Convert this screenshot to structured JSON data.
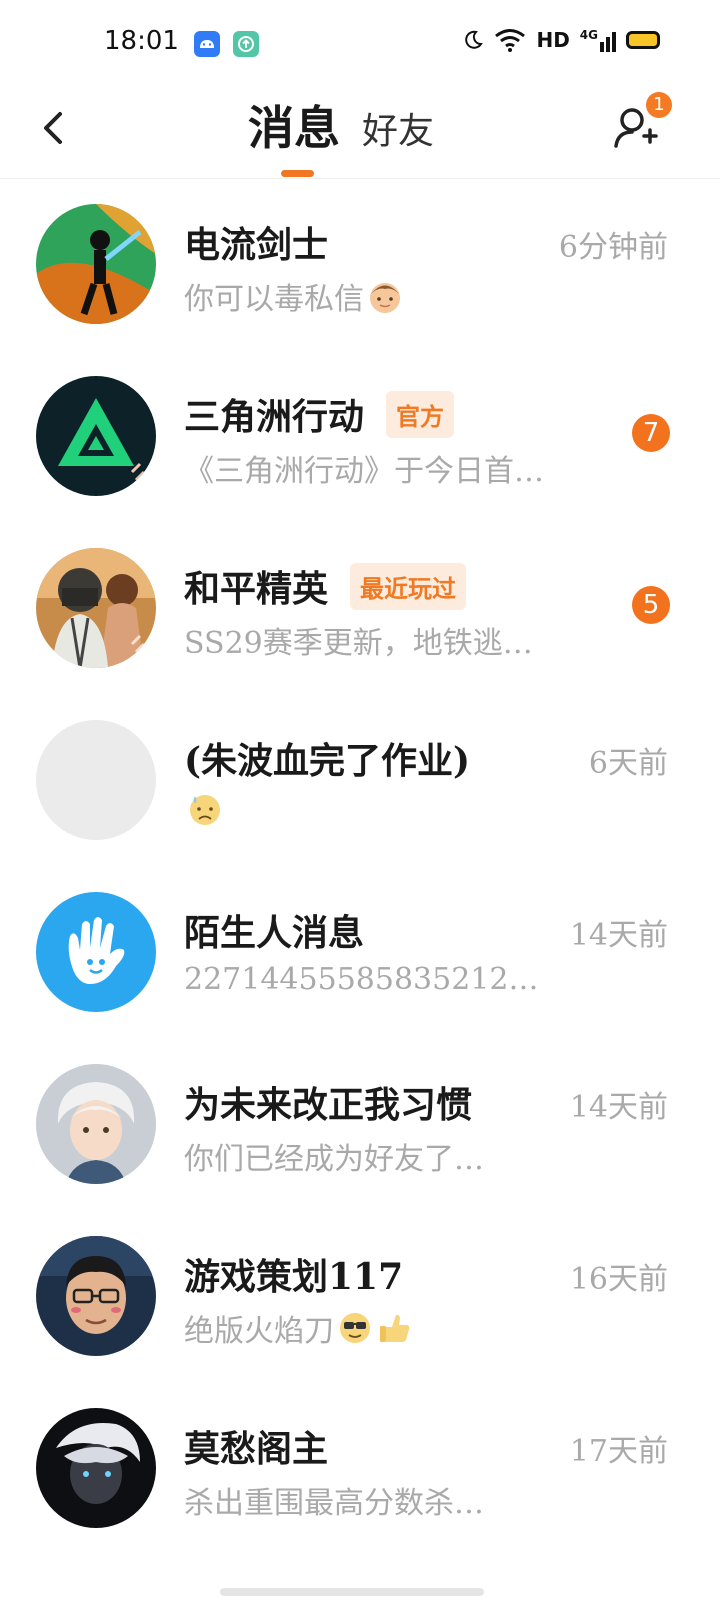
{
  "status_bar": {
    "time": "18:01",
    "hd": "HD",
    "network": "4G",
    "battery_color": "#f7c527"
  },
  "header": {
    "tab_messages": "消息",
    "tab_friends": "好友",
    "notification_count": "1",
    "accent_color": "#f07622"
  },
  "conversations": [
    {
      "name": "电流剑士",
      "tag": "",
      "time": "6分钟前",
      "preview": "你可以毒私信",
      "preview_emoji": "boy-face-emoji",
      "unread": ""
    },
    {
      "name": "三角洲行动",
      "tag": "官方",
      "time": "",
      "preview": "《三角洲行动》于今日首…",
      "preview_emoji": "",
      "unread": "7"
    },
    {
      "name": "和平精英",
      "tag": "最近玩过",
      "time": "",
      "preview": "SS29赛季更新，地铁逃…",
      "preview_emoji": "",
      "unread": "5"
    },
    {
      "name": "(朱波血完了作业)",
      "tag": "",
      "time": "6天前",
      "preview": "",
      "preview_emoji": "sad-sweat-emoji",
      "unread": ""
    },
    {
      "name": "陌生人消息",
      "tag": "",
      "time": "14天前",
      "preview": "22714455585835212…",
      "preview_emoji": "",
      "unread": ""
    },
    {
      "name": "为未来改正我习惯",
      "tag": "",
      "time": "14天前",
      "preview": "你们已经成为好友了…",
      "preview_emoji": "",
      "unread": ""
    },
    {
      "name": "游戏策划117",
      "tag": "",
      "time": "16天前",
      "preview": "绝版火焰刀",
      "preview_emoji": "sunglasses-emoji thumbs-up-emoji",
      "unread": ""
    },
    {
      "name": "莫愁阁主",
      "tag": "",
      "time": "17天前",
      "preview": "杀出重围最高分数杀…",
      "preview_emoji": "",
      "unread": ""
    }
  ]
}
